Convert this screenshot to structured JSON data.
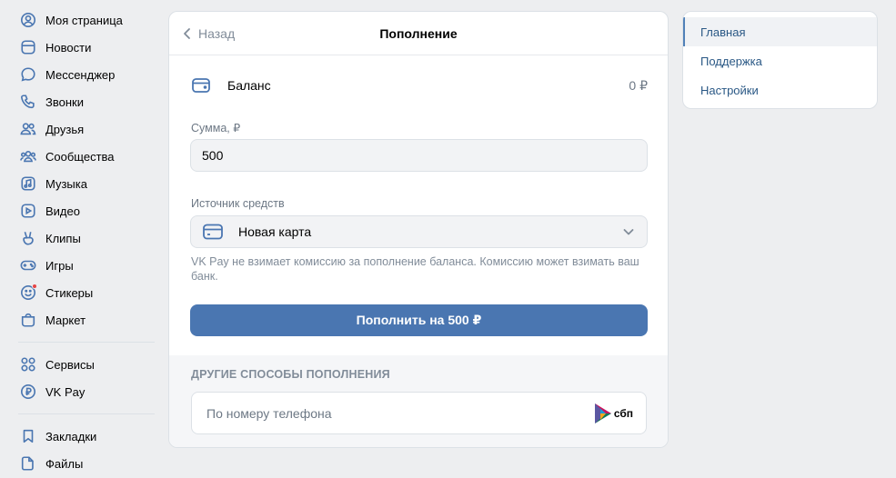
{
  "nav": {
    "items": [
      {
        "label": "Моя страница",
        "icon": "user-circle-icon"
      },
      {
        "label": "Новости",
        "icon": "newsfeed-icon"
      },
      {
        "label": "Мессенджер",
        "icon": "message-icon"
      },
      {
        "label": "Звонки",
        "icon": "phone-icon"
      },
      {
        "label": "Друзья",
        "icon": "friends-icon"
      },
      {
        "label": "Сообщества",
        "icon": "communities-icon"
      },
      {
        "label": "Музыка",
        "icon": "music-icon"
      },
      {
        "label": "Видео",
        "icon": "video-icon"
      },
      {
        "label": "Клипы",
        "icon": "clips-icon"
      },
      {
        "label": "Игры",
        "icon": "gamepad-icon"
      },
      {
        "label": "Стикеры",
        "icon": "smile-icon"
      },
      {
        "label": "Маркет",
        "icon": "bag-icon"
      }
    ],
    "items2": [
      {
        "label": "Сервисы",
        "icon": "services-icon"
      },
      {
        "label": "VK Pay",
        "icon": "ruble-icon"
      }
    ],
    "items3": [
      {
        "label": "Закладки",
        "icon": "bookmark-icon"
      },
      {
        "label": "Файлы",
        "icon": "file-icon"
      }
    ]
  },
  "card": {
    "back_label": "Назад",
    "title": "Пополнение",
    "balance_label": "Баланс",
    "balance_value": "0 ₽",
    "amount_label": "Сумма, ₽",
    "amount_value": "500",
    "source_label": "Источник средств",
    "source_value": "Новая карта",
    "hint": "VK Pay не взимает комиссию за пополнение баланса. Комиссию может взимать ваш банк.",
    "pay_button": "Пополнить на 500 ₽",
    "other_title": "ДРУГИЕ СПОСОБЫ ПОПОЛНЕНИЯ",
    "phone_option": "По номеру телефона",
    "sbp_text": "сбп"
  },
  "right_menu": {
    "items": [
      "Главная",
      "Поддержка",
      "Настройки"
    ],
    "active_index": 0
  },
  "colors": {
    "accent": "#4a76b1",
    "icon": "#4a76b1",
    "link": "#2a5885",
    "background": "#edeef0"
  }
}
